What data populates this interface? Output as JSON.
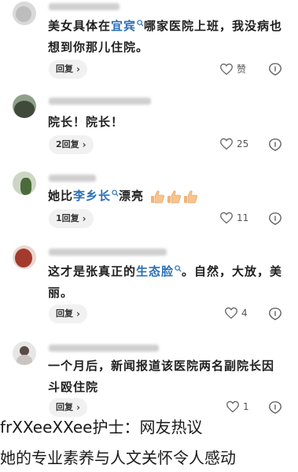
{
  "comments": [
    {
      "text_before": "美女具体在",
      "link": "宜宾",
      "text_after": "哪家医院上班，我没病也想到你那儿住院。",
      "reply_label": "回复",
      "like_label": "赞"
    },
    {
      "text": "院长！院长！",
      "reply_label": "2回复",
      "like_count": "25"
    },
    {
      "text_before": "她比",
      "link": "李乡长",
      "text_after": "漂亮",
      "reply_label": "1回复",
      "like_count": "11"
    },
    {
      "text_before": "这才是张真正的",
      "link": "生态脸",
      "text_after": "。自然，大放，美丽。",
      "reply_label": "回复",
      "like_count": "4"
    },
    {
      "text": "一个月后，新闻报道该医院两名副院长因斗殴住院",
      "reply_label": "回复",
      "like_count": "1"
    }
  ],
  "overlay": {
    "line1": "frXXeeXXee护士：网友热议",
    "line2": "她的专业素养与人文关怀令人感动"
  },
  "colors": {
    "link": "#2a6fb6",
    "reply_bg": "#f1f1f1"
  },
  "icons": [
    "heart-icon",
    "dislike-icon",
    "search-icon",
    "thumbs-up-emoji",
    "chevron-right-icon"
  ]
}
